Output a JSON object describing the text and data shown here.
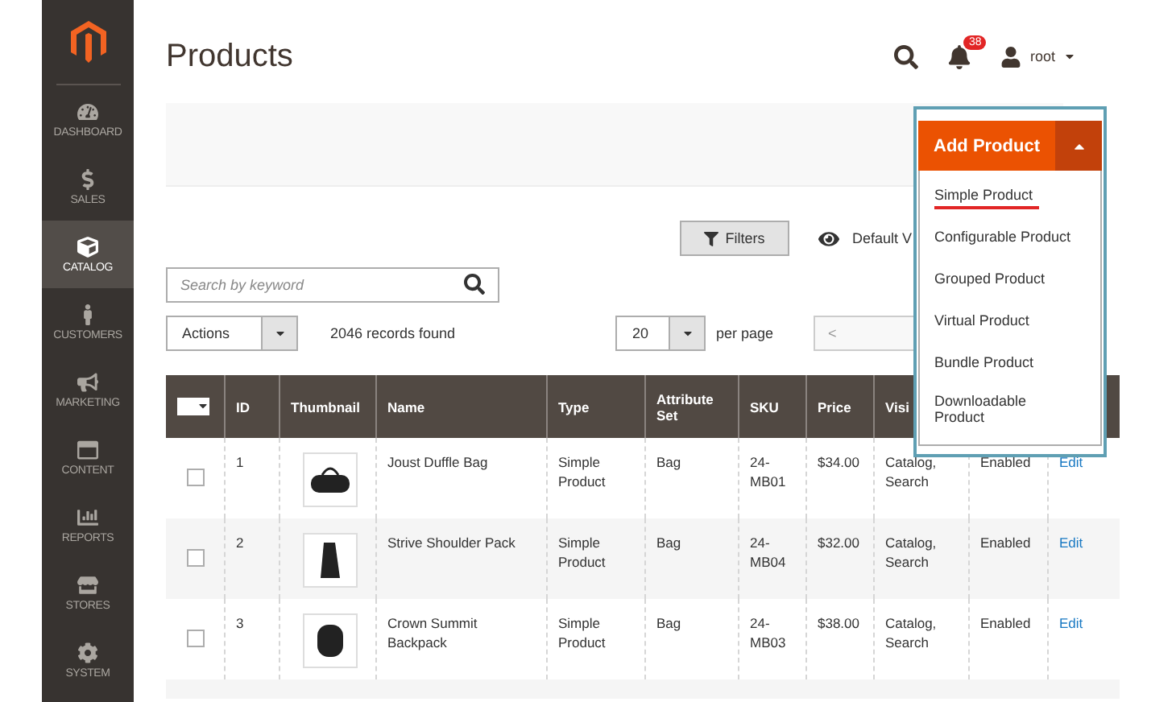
{
  "sidebar": {
    "items": [
      {
        "kind": "dashboard",
        "label": "DASHBOARD",
        "selected": false
      },
      {
        "kind": "sales",
        "label": "SALES",
        "selected": false
      },
      {
        "kind": "catalog",
        "label": "CATALOG",
        "selected": true
      },
      {
        "kind": "customers",
        "label": "CUSTOMERS",
        "selected": false
      },
      {
        "kind": "marketing",
        "label": "MARKETING",
        "selected": false
      },
      {
        "kind": "content",
        "label": "CONTENT",
        "selected": false
      },
      {
        "kind": "reports",
        "label": "REPORTS",
        "selected": false
      },
      {
        "kind": "stores",
        "label": "STORES",
        "selected": false
      },
      {
        "kind": "system",
        "label": "SYSTEM",
        "selected": false
      }
    ]
  },
  "header": {
    "title": "Products",
    "notifications": "38",
    "user": "root"
  },
  "add_product": {
    "label": "Add Product",
    "expanded": true,
    "menu": [
      {
        "label": "Simple Product",
        "selected": true
      },
      {
        "label": "Configurable Product",
        "selected": false
      },
      {
        "label": "Grouped Product",
        "selected": false
      },
      {
        "label": "Virtual Product",
        "selected": false
      },
      {
        "label": "Bundle Product",
        "selected": false
      },
      {
        "label": "Downloadable Product",
        "selected": false
      }
    ]
  },
  "toolbar": {
    "filters": "Filters",
    "view": "Default V",
    "search": {
      "placeholder": "Search by keyword"
    },
    "actions": "Actions",
    "records": "2046 records found",
    "page_size": "20",
    "per_page": "per page",
    "prev": "<"
  },
  "table": {
    "select_all": {
      "checked": false
    },
    "columns": [
      "ID",
      "Thumbnail",
      "Name",
      "Type",
      "Attribute Set",
      "SKU",
      "Price",
      "Visi"
    ],
    "rows": [
      {
        "id": "1",
        "name": "Joust Duffle Bag",
        "type": "Simple Product",
        "attribute_set": "Bag",
        "sku": "24-MB01",
        "price": "$34.00",
        "visibility": "Catalog, Search",
        "column_10": "Enabled",
        "action": "Edit",
        "checked": false,
        "kind": "duffle"
      },
      {
        "id": "2",
        "name": "Strive Shoulder Pack",
        "type": "Simple Product",
        "attribute_set": "Bag",
        "sku": "24-MB04",
        "price": "$32.00",
        "visibility": "Catalog, Search",
        "column_10": "Enabled",
        "action": "Edit",
        "checked": false,
        "kind": "sling"
      },
      {
        "id": "3",
        "name": "Crown Summit Backpack",
        "type": "Simple Product",
        "attribute_set": "Bag",
        "sku": "24-MB03",
        "price": "$38.00",
        "visibility": "Catalog, Search",
        "column_10": "Enabled",
        "action": "Edit",
        "checked": false,
        "kind": "backpack"
      }
    ]
  }
}
